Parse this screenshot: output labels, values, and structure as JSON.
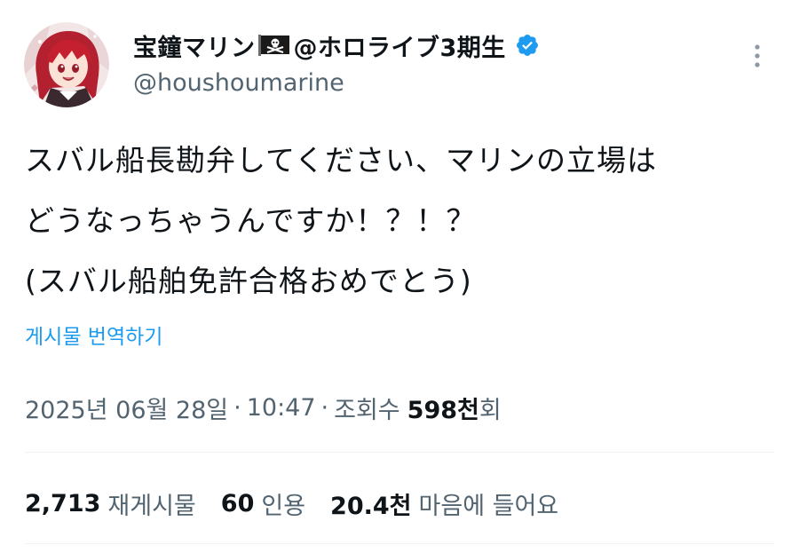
{
  "author": {
    "display_name": "宝鐘マリン",
    "flag_emoji": "🏴‍☠️",
    "group_suffix": "@ホロライブ3期生",
    "handle": "@houshoumarine",
    "verified": true
  },
  "tweet": {
    "lines": [
      "スバル船長勘弁してください、マリンの立場は",
      "どうなっちゃうんですか！？！？",
      "(スバル船舶免許合格おめでとう)"
    ]
  },
  "translate_label": "게시물 번역하기",
  "meta": {
    "date": "2025년 06월 28일",
    "time": "10:47",
    "views_prefix": "조회수",
    "views_count": "598천",
    "views_suffix": "회",
    "separator": "·"
  },
  "stats": {
    "retweets_count": "2,713",
    "retweets_label": "재게시물",
    "quotes_count": "60",
    "quotes_label": "인용",
    "likes_count": "20.4천",
    "likes_label": "마음에 들어요"
  },
  "colors": {
    "accent": "#1d9bf0",
    "text_primary": "#0f1419",
    "text_secondary": "#536471",
    "divider": "#eff3f4"
  },
  "icons": {
    "more": "more-vertical-icon",
    "verified": "verified-badge-icon",
    "flag": "pirate-flag-icon"
  }
}
